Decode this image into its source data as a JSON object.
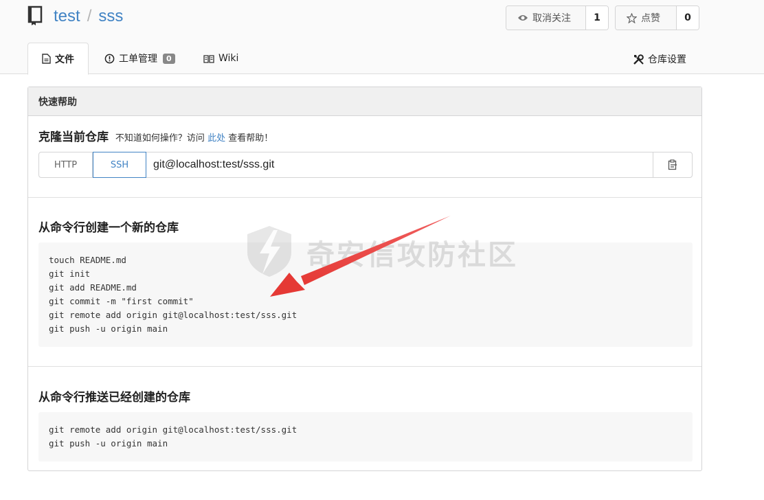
{
  "repo": {
    "owner": "test",
    "separator": "/",
    "name": "sss"
  },
  "watch": {
    "label": "取消关注",
    "count": "1",
    "icon": "eye-icon"
  },
  "star": {
    "label": "点赞",
    "count": "0",
    "icon": "star-icon"
  },
  "tabs": [
    {
      "label": "文件",
      "icon": "file-icon",
      "active": true
    },
    {
      "label": "工单管理",
      "icon": "issue-icon",
      "badge": "0"
    },
    {
      "label": "Wiki",
      "icon": "book-icon"
    }
  ],
  "settings": {
    "label": "仓库设置",
    "icon": "tools-icon"
  },
  "quick_help": {
    "header": "快速帮助",
    "clone_title": "克隆当前仓库",
    "help_prefix": "不知道如何操作？访问",
    "help_link": "此处",
    "help_suffix": "查看帮助！",
    "protocols": [
      "HTTP",
      "SSH"
    ],
    "selected_protocol": "SSH",
    "clone_url": "git@localhost:test/sss.git"
  },
  "new_repo": {
    "title": "从命令行创建一个新的仓库",
    "commands": [
      "touch README.md",
      "git init",
      "git add README.md",
      "git commit -m \"first commit\"",
      "git remote add origin git@localhost:test/sss.git",
      "git push -u origin main"
    ]
  },
  "push_existing": {
    "title": "从命令行推送已经创建的仓库",
    "commands": [
      "git remote add origin git@localhost:test/sss.git",
      "git push -u origin main"
    ]
  },
  "watermark": {
    "text": "奇安信攻防社区"
  },
  "colors": {
    "link": "#4183c4",
    "arrow": "#e8383d",
    "header_bg": "#fafafa"
  }
}
